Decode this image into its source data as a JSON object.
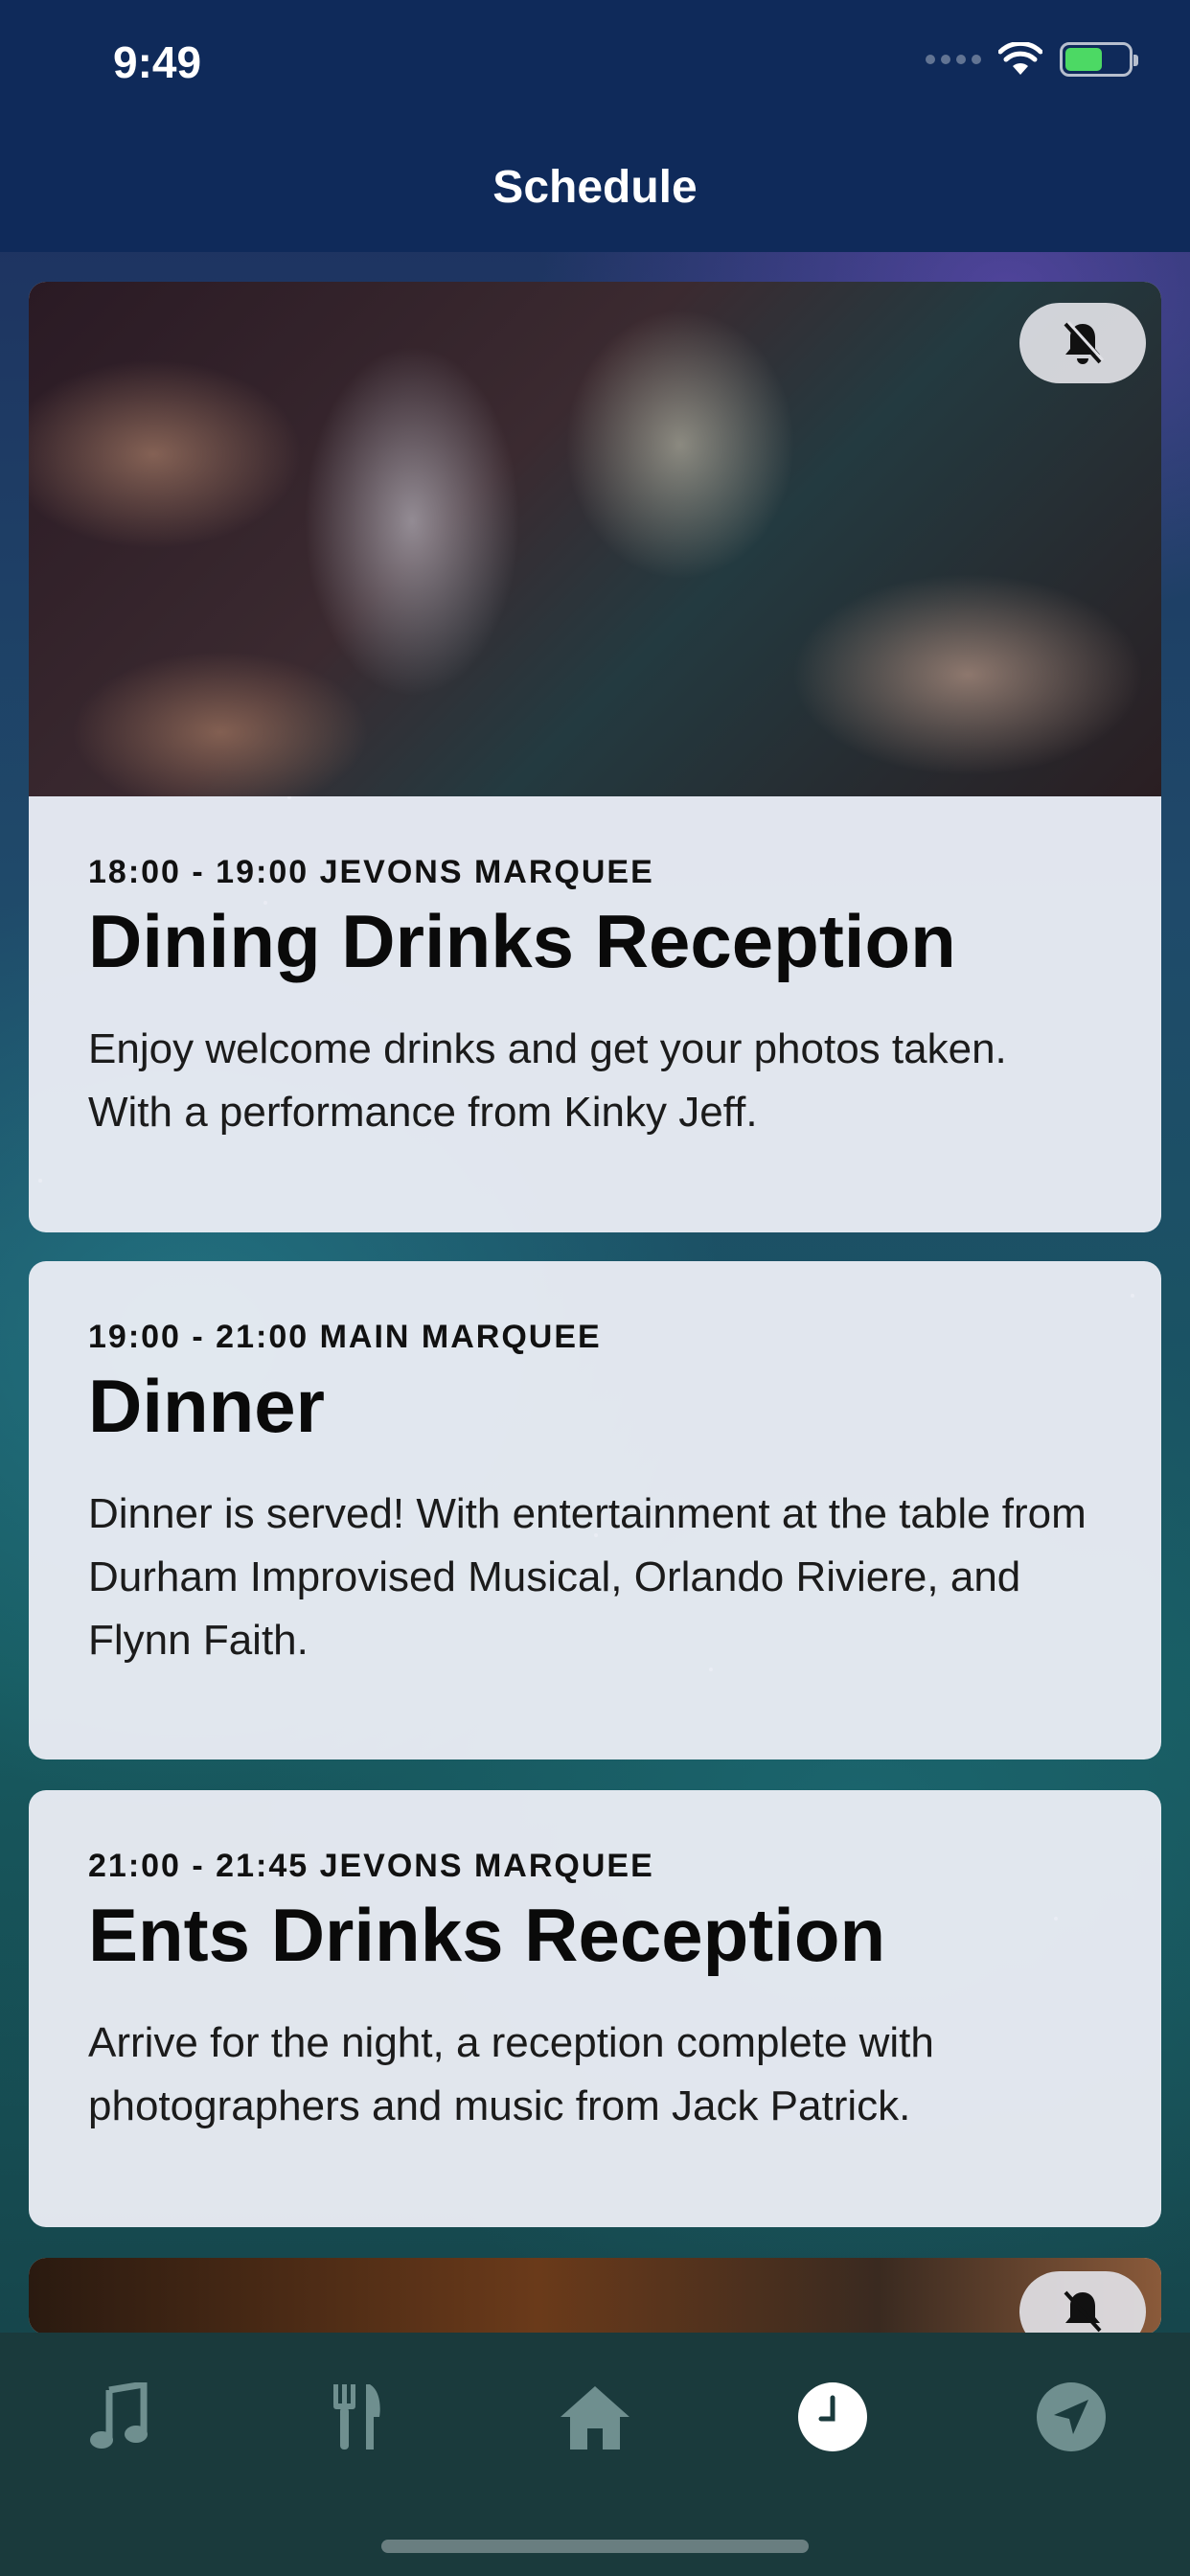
{
  "status_bar": {
    "time": "9:49"
  },
  "header": {
    "title": "Schedule"
  },
  "cards": [
    {
      "meta": "18:00 - 19:00 JEVONS MARQUEE",
      "title": "Dining Drinks Reception",
      "description": "Enjoy welcome drinks and get your photos taken. With a performance from Kinky Jeff.",
      "has_image": true,
      "image_icon": "bell-slash-icon"
    },
    {
      "meta": "19:00 - 21:00 MAIN MARQUEE",
      "title": "Dinner",
      "description": "Dinner is served! With entertainment at the table from Durham Improvised Musical, Orlando Riviere, and Flynn Faith."
    },
    {
      "meta": "21:00 - 21:45 JEVONS MARQUEE",
      "title": "Ents Drinks Reception",
      "description": "Arrive for the night, a reception complete with photographers and music from Jack Patrick."
    }
  ],
  "tabs": [
    {
      "icon": "music-note-icon",
      "active": false
    },
    {
      "icon": "fork-knife-icon",
      "active": false
    },
    {
      "icon": "home-icon",
      "active": false
    },
    {
      "icon": "clock-icon",
      "active": true
    },
    {
      "icon": "location-arrow-icon",
      "active": false
    }
  ],
  "colors": {
    "header_bg": "#0f2a5a",
    "card_bg": "#eceef5",
    "tabbar_bg": "#1a3a3c",
    "tab_icon_inactive": "#6f8f8f",
    "tab_icon_active": "#ffffff"
  }
}
